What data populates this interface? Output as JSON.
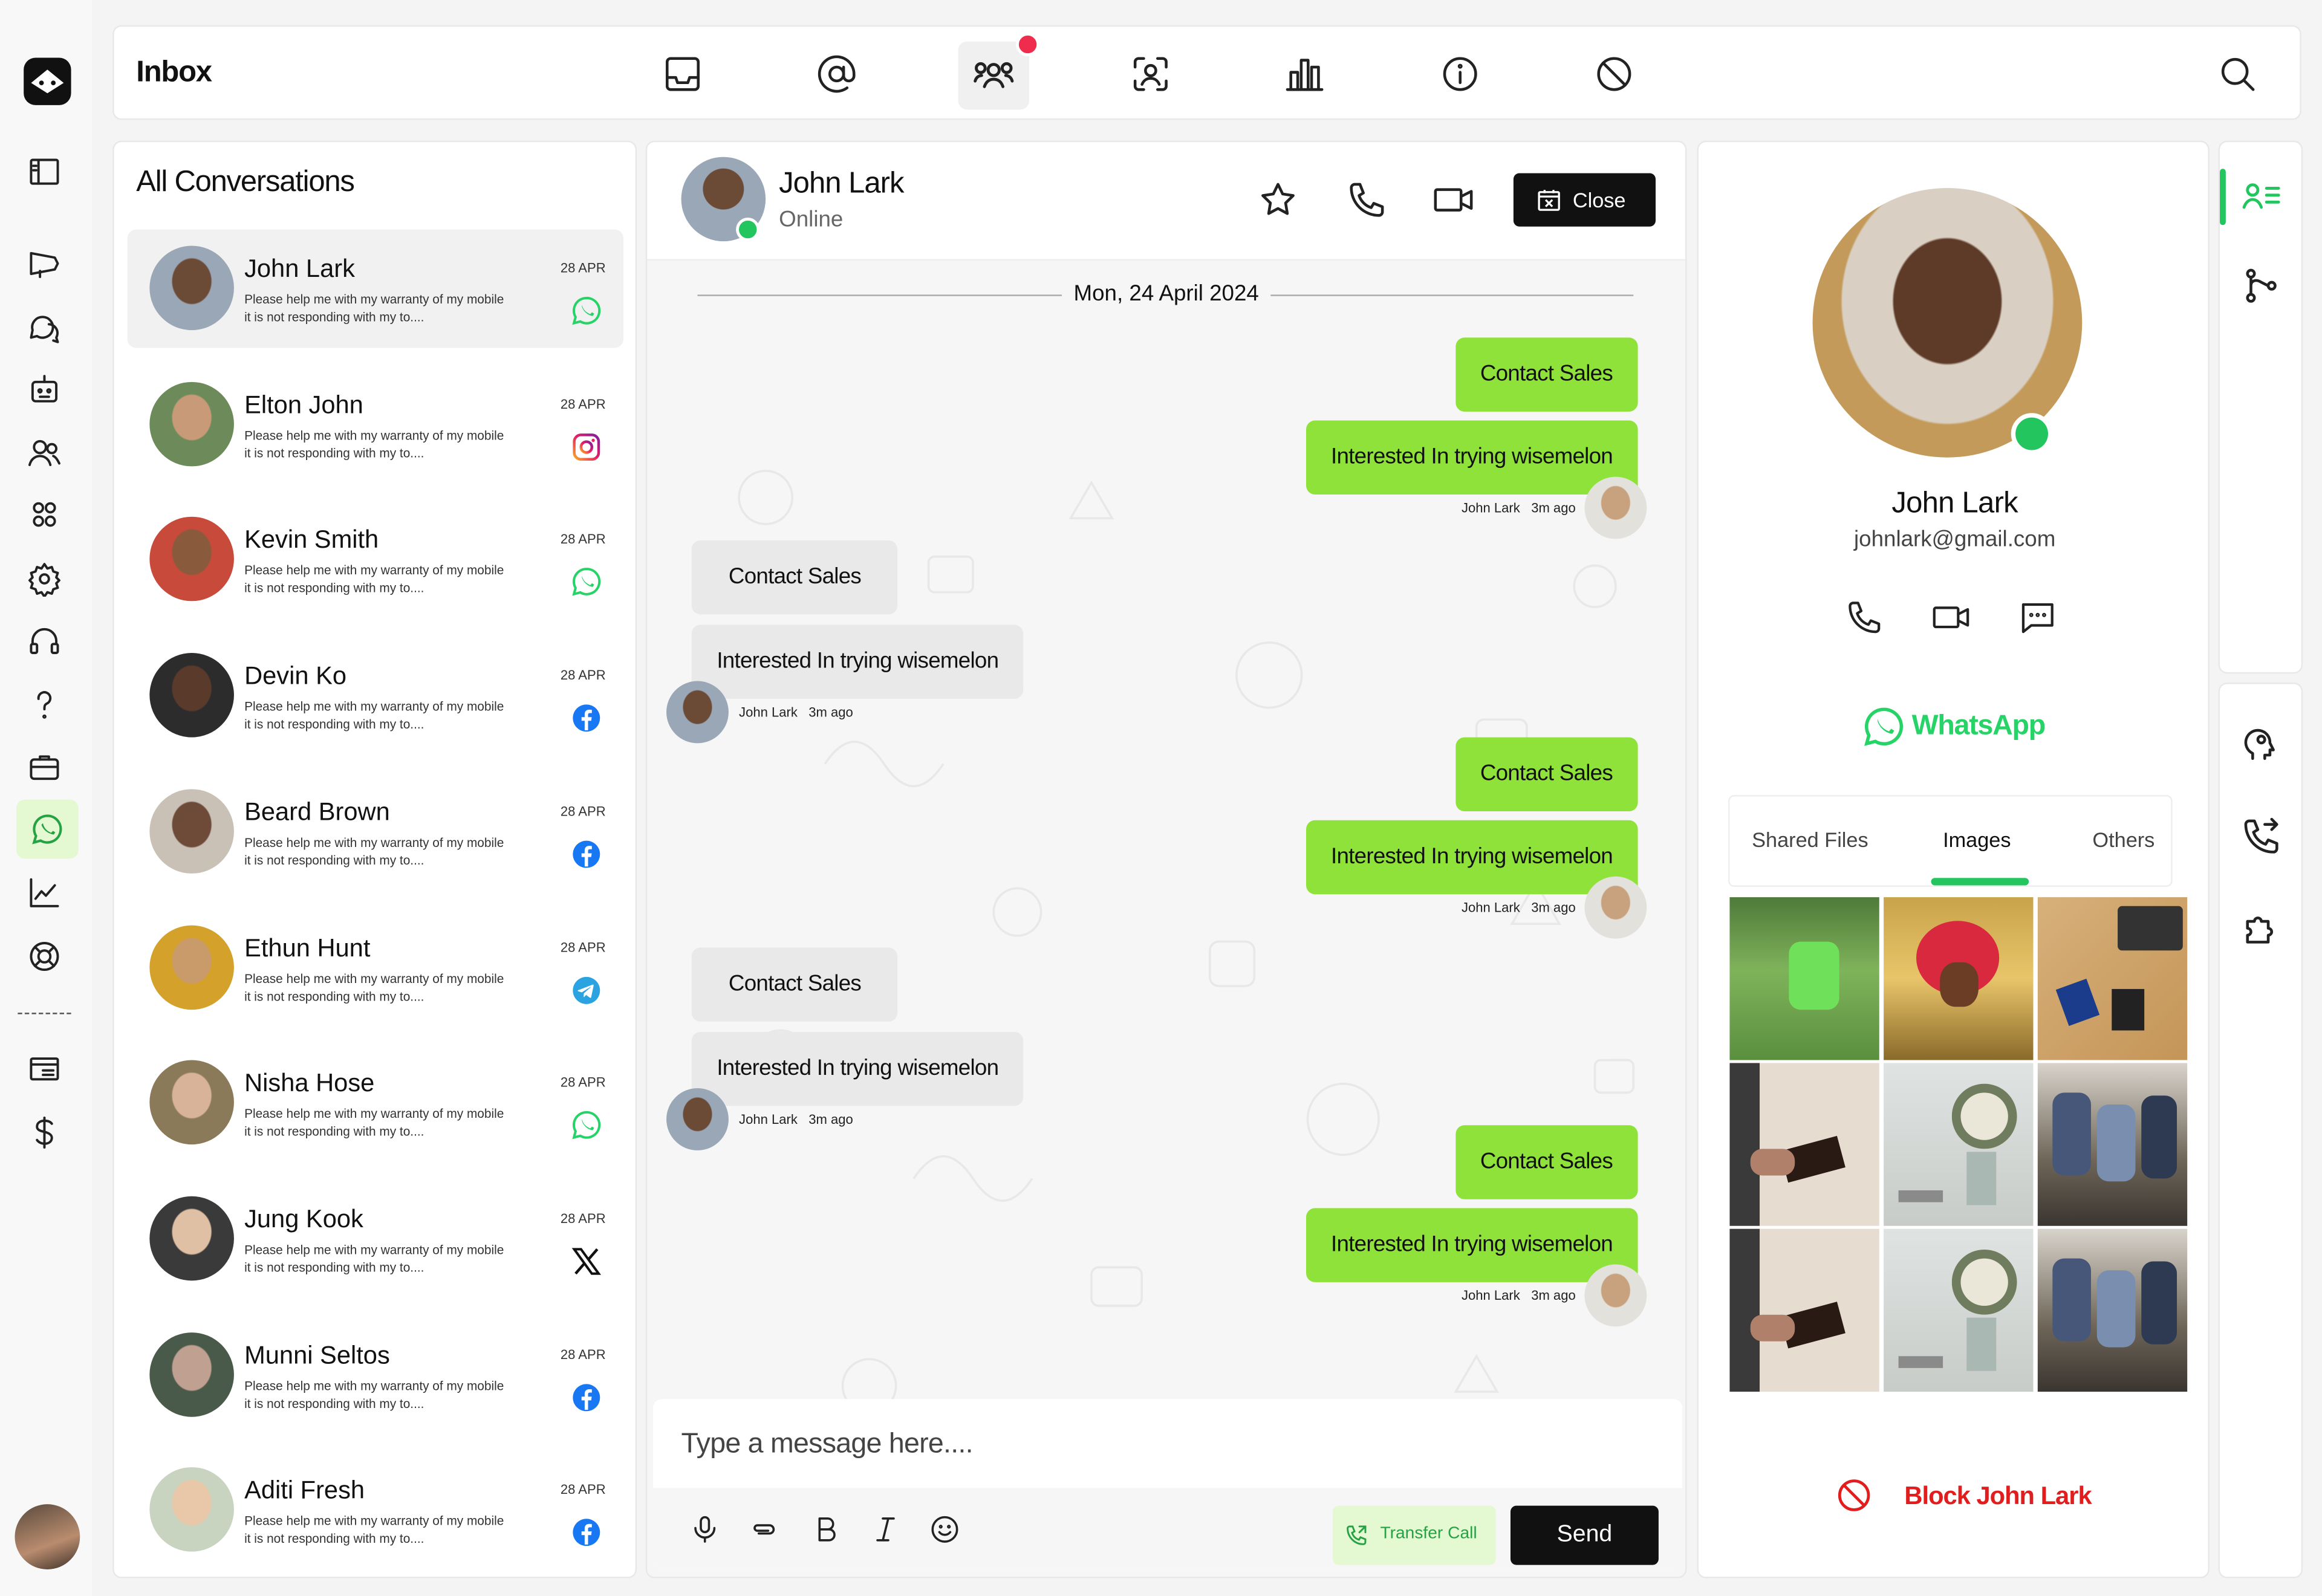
{
  "topbar": {
    "title": "Inbox"
  },
  "conversations": {
    "title": "All Conversations",
    "items": [
      {
        "name": "John Lark",
        "preview1": "Please help me with my warranty of my mobile",
        "preview2": "it is not responding with my to....",
        "date": "28 APR",
        "platform": "whatsapp"
      },
      {
        "name": "Elton John",
        "preview1": "Please help me with my warranty of my mobile",
        "preview2": "it is not responding with my to....",
        "date": "28 APR",
        "platform": "instagram"
      },
      {
        "name": "Kevin Smith",
        "preview1": "Please help me with my warranty of my mobile",
        "preview2": "it is not responding with my to....",
        "date": "28 APR",
        "platform": "whatsapp"
      },
      {
        "name": "Devin Ko",
        "preview1": "Please help me with my warranty of my mobile",
        "preview2": "it is not responding with my to....",
        "date": "28 APR",
        "platform": "facebook"
      },
      {
        "name": "Beard Brown",
        "preview1": "Please help me with my warranty of my mobile",
        "preview2": "it is not responding with my to....",
        "date": "28 APR",
        "platform": "facebook"
      },
      {
        "name": "Ethun Hunt",
        "preview1": "Please help me with my warranty of my mobile",
        "preview2": "it is not responding with my to....",
        "date": "28 APR",
        "platform": "telegram"
      },
      {
        "name": "Nisha Hose",
        "preview1": "Please help me with my warranty of my mobile",
        "preview2": "it is not responding with my to....",
        "date": "28 APR",
        "platform": "whatsapp"
      },
      {
        "name": "Jung Kook",
        "preview1": "Please help me with my warranty of my mobile",
        "preview2": "it is not responding with my to....",
        "date": "28 APR",
        "platform": "x"
      },
      {
        "name": "Munni Seltos",
        "preview1": "Please help me with my warranty of my mobile",
        "preview2": "it is not responding with my to....",
        "date": "28 APR",
        "platform": "facebook"
      },
      {
        "name": "Aditi Fresh",
        "preview1": "Please help me with my warranty of my mobile",
        "preview2": "it is not responding with my to....",
        "date": "28 APR",
        "platform": "facebook"
      }
    ]
  },
  "chat": {
    "contact_name": "John Lark",
    "status": "Online",
    "close_label": "Close",
    "date_divider": "Mon, 24 April 2024",
    "messages": [
      {
        "dir": "out",
        "text": "Contact Sales"
      },
      {
        "dir": "out",
        "text": "Interested In trying wisemelon",
        "sender": "John Lark",
        "time": "3m ago"
      },
      {
        "dir": "in",
        "text": "Contact Sales"
      },
      {
        "dir": "in",
        "text": "Interested In trying wisemelon",
        "sender": "John Lark",
        "time": "3m ago"
      },
      {
        "dir": "out",
        "text": "Contact Sales"
      },
      {
        "dir": "out",
        "text": "Interested In trying wisemelon",
        "sender": "John Lark",
        "time": "3m ago"
      },
      {
        "dir": "in",
        "text": "Contact Sales"
      },
      {
        "dir": "in",
        "text": "Interested In trying wisemelon",
        "sender": "John Lark",
        "time": "3m ago"
      },
      {
        "dir": "out",
        "text": "Contact Sales"
      },
      {
        "dir": "out",
        "text": "Interested In trying wisemelon",
        "sender": "John Lark",
        "time": "3m ago"
      }
    ],
    "input_placeholder": "Type a message here....",
    "transfer_label": "Transfer Call",
    "send_label": "Send"
  },
  "profile": {
    "name": "John Lark",
    "email": "johnlark@gmail.com",
    "channel": "WhatsApp",
    "tabs": [
      "Shared Files",
      "Images",
      "Others"
    ],
    "active_tab": "Images",
    "block_label": "Block John Lark"
  },
  "colors": {
    "accent": "#8fe23a",
    "whatsapp": "#25d366",
    "online": "#22c55e",
    "block": "#e11d1d",
    "notification": "#ef2b4e"
  }
}
